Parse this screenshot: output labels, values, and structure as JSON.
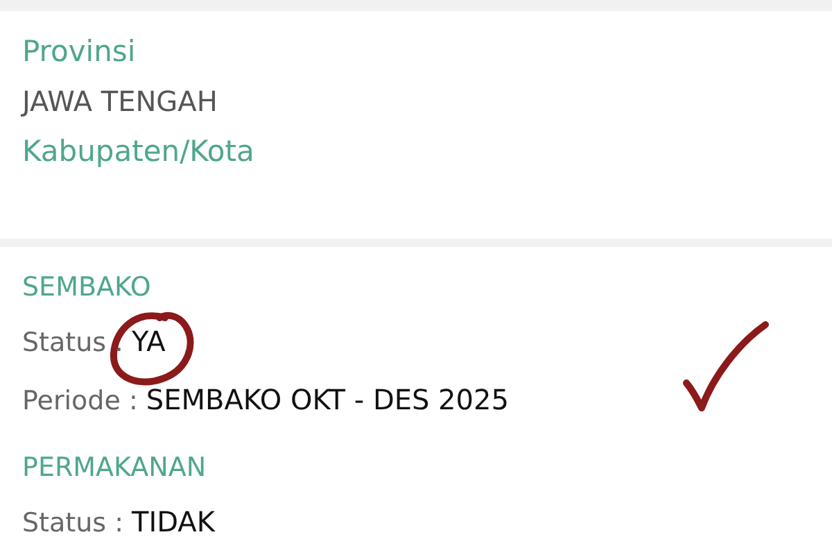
{
  "location": [
    {
      "label": "Provinsi",
      "value": "JAWA TENGAH"
    },
    {
      "label": "Kabupaten/Kota"
    }
  ],
  "programs": [
    {
      "name": "SEMBAKO",
      "fields": [
        {
          "label": "Status :",
          "value": "YA",
          "circled": true,
          "checked": false
        },
        {
          "label": "Periode :",
          "value": "SEMBAKO OKT - DES 2025",
          "circled": false,
          "checked": true
        }
      ]
    },
    {
      "name": "PERMAKANAN",
      "fields": [
        {
          "label": "Status :",
          "value": "TIDAK",
          "circled": false,
          "checked": false
        }
      ]
    }
  ]
}
